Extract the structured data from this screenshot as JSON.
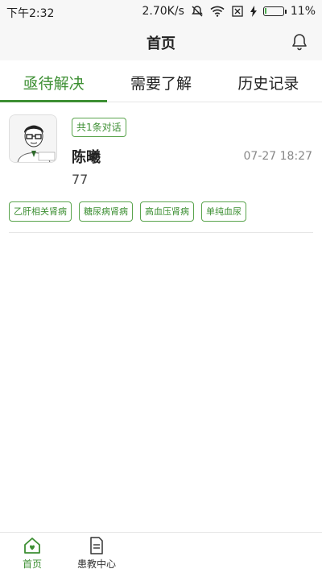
{
  "status_bar": {
    "time": "下午2:32",
    "speed": "2.70K/s",
    "battery": "11%",
    "battery_level": 0.11,
    "battery_color": "#4caf50"
  },
  "header": {
    "title": "首页"
  },
  "tabs": [
    {
      "label": "亟待解决",
      "active": true
    },
    {
      "label": "需要了解",
      "active": false
    },
    {
      "label": "历史记录",
      "active": false
    }
  ],
  "conversation": {
    "badge": "共1条对话",
    "name": "陈曦",
    "datetime": "07-27 18:27",
    "message": "77",
    "tags": [
      "乙肝相关肾病",
      "糖尿病肾病",
      "高血压肾病",
      "单纯血尿"
    ]
  },
  "bottom_nav": [
    {
      "label": "首页",
      "icon": "home-heart-icon",
      "active": true
    },
    {
      "label": "患教中心",
      "icon": "document-icon",
      "active": false
    }
  ],
  "colors": {
    "accent": "#3d8f33",
    "header_bg": "#f7f7f7"
  }
}
